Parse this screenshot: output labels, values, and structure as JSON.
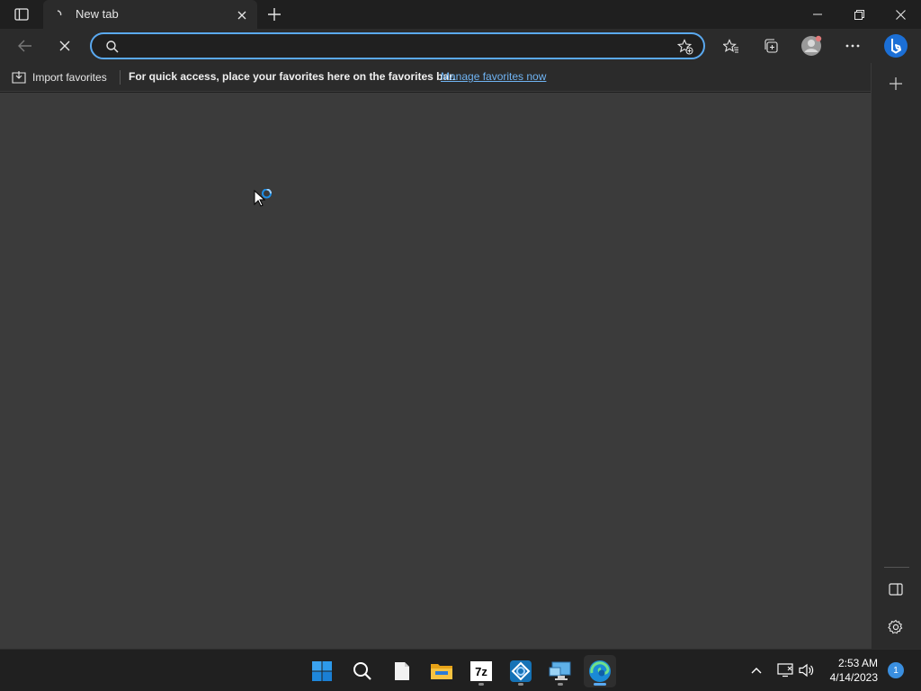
{
  "browser": {
    "tab": {
      "title": "New tab"
    },
    "address_bar": {
      "value": "",
      "placeholder": ""
    },
    "favorites_bar": {
      "import_label": "Import favorites",
      "message": "For quick access, place your favorites here on the favorites bar.",
      "link_label": "Manage favorites now"
    },
    "accent_color": "#5aa9f0"
  },
  "taskbar": {
    "apps": [
      {
        "name": "Start",
        "icon": "windows-logo-icon"
      },
      {
        "name": "Search",
        "icon": "search-icon"
      },
      {
        "name": "Notepad",
        "icon": "document-icon"
      },
      {
        "name": "File Explorer",
        "icon": "folder-icon"
      },
      {
        "name": "7-Zip",
        "icon": "7zip-icon",
        "label": "7z"
      },
      {
        "name": "App",
        "icon": "network-app-icon"
      },
      {
        "name": "Remote Desktop",
        "icon": "remote-desktop-icon"
      },
      {
        "name": "Microsoft Edge",
        "icon": "edge-icon"
      }
    ],
    "clock": {
      "time": "2:53 AM",
      "date": "4/14/2023"
    },
    "notification_count": "1"
  }
}
